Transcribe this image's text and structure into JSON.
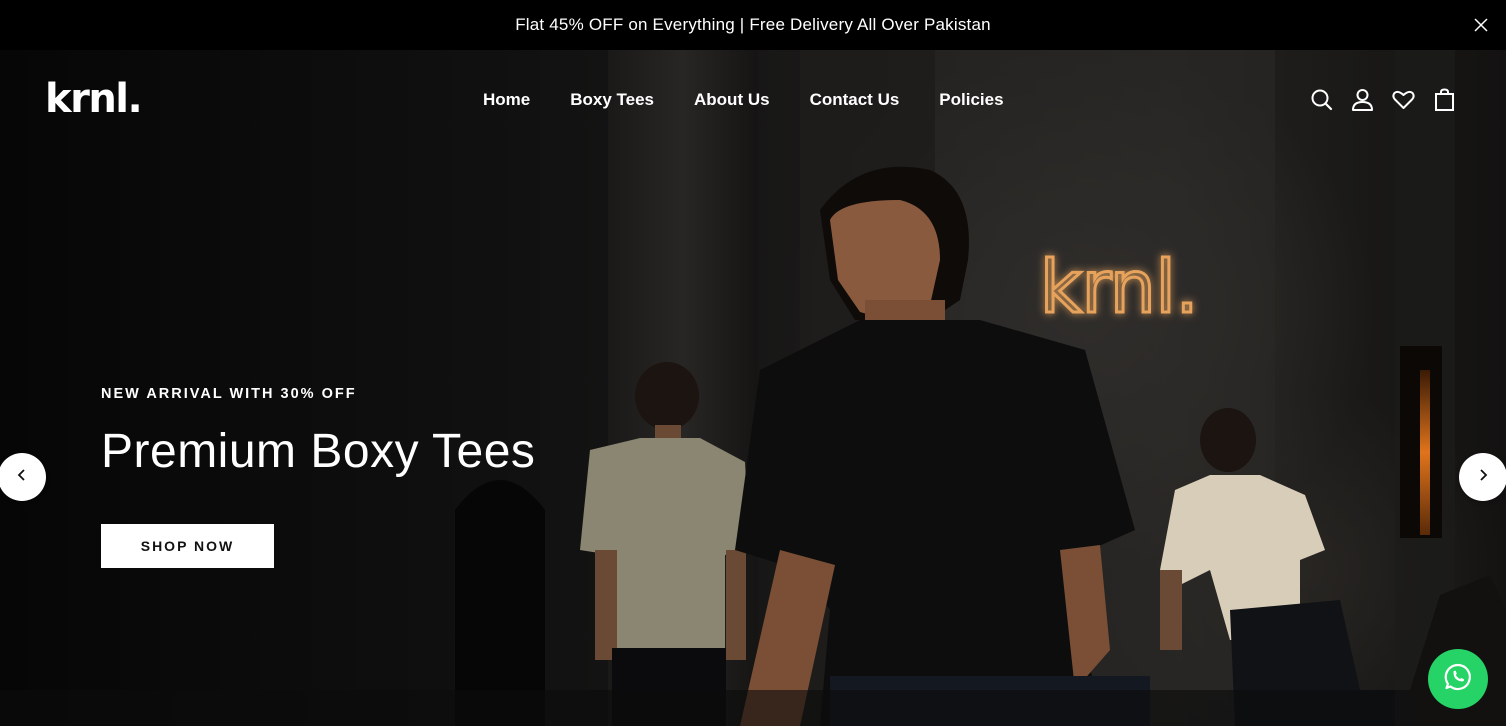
{
  "announcement": {
    "text": "Flat 45% OFF on Everything | Free Delivery All Over Pakistan",
    "close_icon": "close-icon"
  },
  "header": {
    "logo": "krnl.",
    "nav": [
      {
        "label": "Home"
      },
      {
        "label": "Boxy Tees"
      },
      {
        "label": "About Us"
      },
      {
        "label": "Contact Us"
      },
      {
        "label": "Policies"
      }
    ],
    "icons": [
      "search-icon",
      "account-icon",
      "wishlist-heart-icon",
      "cart-bag-icon"
    ]
  },
  "hero": {
    "eyebrow": "NEW ARRIVAL WITH 30% OFF",
    "headline": "Premium Boxy Tees",
    "cta_label": "SHOP NOW",
    "wall_sign": "krnl.",
    "prev_icon": "chevron-left-icon",
    "next_icon": "chevron-right-icon"
  },
  "whatsapp": {
    "icon": "whatsapp-icon"
  },
  "colors": {
    "background": "#000000",
    "text": "#ffffff",
    "button_bg": "#ffffff",
    "button_text": "#111111",
    "whatsapp_green": "#25d366",
    "neon_sign": "#e7a35b"
  }
}
